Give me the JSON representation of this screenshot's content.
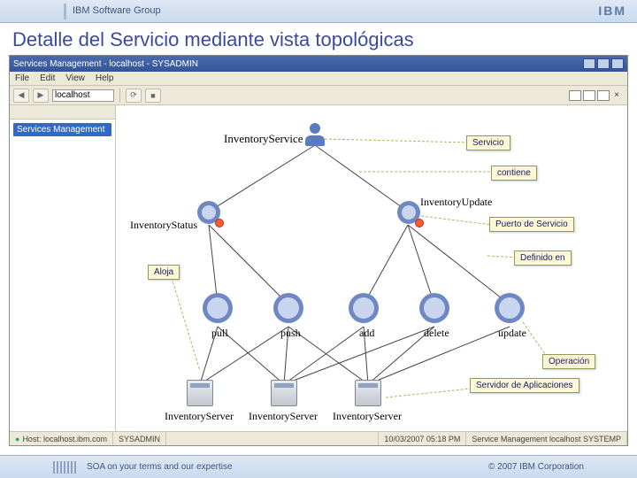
{
  "slide": {
    "group_label": "IBM Software Group",
    "logo": "IBM",
    "title": "Detalle del Servicio mediante vista topológicas",
    "footer_left": "SOA on your terms and our expertise",
    "footer_right": "© 2007 IBM Corporation"
  },
  "appwindow": {
    "title": "Services Management - localhost - SYSADMIN",
    "menu": [
      "File",
      "Edit",
      "View",
      "Help"
    ],
    "toolbar": {
      "history_value": "localhost",
      "nav_back": "◀",
      "nav_fwd": "▶"
    },
    "sidebar": {
      "root_node": "Services Management"
    },
    "statusbar": {
      "left": "Host: localhost.ibm.com",
      "mid": "SYSADMIN",
      "right1": "10/03/2007 05:18 PM",
      "right2": "Service Management  localhost  SYSTEMP"
    }
  },
  "topology": {
    "service_label": "InventoryService",
    "update_label": "InventoryUpdate",
    "status_label": "InventoryStatus",
    "operations": [
      "pull",
      "push",
      "add",
      "delete",
      "update"
    ],
    "servers": [
      "InventoryServer",
      "InventoryServer",
      "InventoryServer"
    ]
  },
  "callouts": {
    "servicio": "Servicio",
    "contiene": "contiene",
    "puerto": "Puerto de Servicio",
    "definido": "Definido en",
    "aloja": "Aloja",
    "operacion": "Operación",
    "servidor_app": "Servidor de Aplicaciones"
  }
}
